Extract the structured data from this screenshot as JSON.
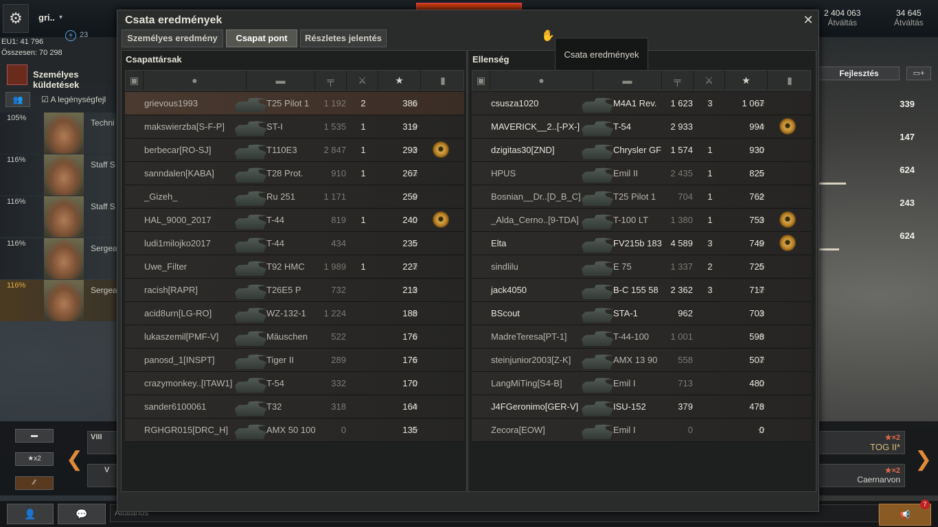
{
  "garage": {
    "account_name": "gri..",
    "plus_value": "23",
    "eu1": "EU1: 41 796",
    "osszesen": "Összesen: 70 298",
    "mission_label": "Személyes küldetések",
    "crew_label": "A legénységfejl",
    "crew": [
      {
        "pct": "105%",
        "rank": "Techni"
      },
      {
        "pct": "116%",
        "rank": "Staff S"
      },
      {
        "pct": "116%",
        "rank": "Staff S"
      },
      {
        "pct": "116%",
        "rank": "Sergea"
      },
      {
        "pct": "116%",
        "rank": "Sergea"
      }
    ],
    "gold": {
      "value": "2 404 063",
      "label": "Átváltás"
    },
    "free_xp": {
      "value": "34 645",
      "label": "Átváltás"
    },
    "fejlesztes": "Fejlesztés",
    "stats": [
      "339",
      "147",
      "624",
      "243",
      "624"
    ],
    "carousel": {
      "btn_x2": "x2",
      "tile_tog": "TOG II*",
      "tile_caer": "Caernarvon",
      "badge": "x2",
      "tile_left1": "VIII",
      "tile_left2": "V"
    },
    "chat_placeholder": "Általános",
    "notif_count": "7"
  },
  "window": {
    "title": "Csata eredmények",
    "tooltip": "Csata eredmények",
    "tabs": [
      "Személyes eredmény",
      "Csapat pont",
      "Részletes jelentés"
    ],
    "allies_title": "Csapattársak",
    "enemies_title": "Ellenség",
    "star": "☆",
    "allies": [
      {
        "name": "grievous1993",
        "tank": "T25 Pilot 1",
        "dmg": "1 192",
        "kills": "2",
        "xp": "386",
        "medal": false,
        "dim": true,
        "me": true
      },
      {
        "name": "makswierzba[S-F-P]",
        "tank": "ST-I",
        "dmg": "1 535",
        "kills": "1",
        "xp": "319",
        "medal": false,
        "dim": true
      },
      {
        "name": "berbecar[RO-SJ]",
        "tank": "T110E3",
        "dmg": "2 847",
        "kills": "1",
        "xp": "293",
        "medal": true,
        "dim": true
      },
      {
        "name": "sanndalen[KABA]",
        "tank": "T28 Prot.",
        "dmg": "910",
        "kills": "1",
        "xp": "267",
        "medal": false,
        "dim": true
      },
      {
        "name": "_Gizeh_",
        "tank": "Ru 251",
        "dmg": "1 171",
        "kills": "",
        "xp": "259",
        "medal": false,
        "dim": true
      },
      {
        "name": "HAL_9000_2017",
        "tank": "T-44",
        "dmg": "819",
        "kills": "1",
        "xp": "240",
        "medal": true,
        "dim": true
      },
      {
        "name": "ludi1milojko2017",
        "tank": "T-44",
        "dmg": "434",
        "kills": "",
        "xp": "235",
        "medal": false,
        "dim": true
      },
      {
        "name": "Uwe_Filter",
        "tank": "T92 HMC",
        "dmg": "1 989",
        "kills": "1",
        "xp": "227",
        "medal": false,
        "dim": true
      },
      {
        "name": "racish[RAPR]",
        "tank": "T26E5 P",
        "dmg": "732",
        "kills": "",
        "xp": "213",
        "medal": false,
        "dim": true
      },
      {
        "name": "acid8urn[LG-RO]",
        "tank": "WZ-132-1",
        "dmg": "1 224",
        "kills": "",
        "xp": "188",
        "medal": false,
        "dim": true
      },
      {
        "name": "lukaszemil[PMF-V]",
        "tank": "Mäuschen",
        "dmg": "522",
        "kills": "",
        "xp": "176",
        "medal": false,
        "dim": true
      },
      {
        "name": "panosd_1[INSPT]",
        "tank": "Tiger II",
        "dmg": "289",
        "kills": "",
        "xp": "176",
        "medal": false,
        "dim": true
      },
      {
        "name": "crazymonkey..[ITAW1]",
        "tank": "T-54",
        "dmg": "332",
        "kills": "",
        "xp": "170",
        "medal": false,
        "dim": true
      },
      {
        "name": "sander6100061",
        "tank": "T32",
        "dmg": "318",
        "kills": "",
        "xp": "164",
        "medal": false,
        "dim": true
      },
      {
        "name": "RGHGR015[DRC_H]",
        "tank": "AMX 50 100",
        "dmg": "0",
        "kills": "",
        "xp": "135",
        "medal": false,
        "dim": true
      }
    ],
    "enemies": [
      {
        "name": "csusza1020",
        "tank": "M4A1 Rev.",
        "dmg": "1 623",
        "kills": "3",
        "xp": "1 067",
        "medal": false,
        "dim": false,
        "bright": true
      },
      {
        "name": "MAVERICK__2..[-PX-]",
        "tank": "T-54",
        "dmg": "2 933",
        "kills": "",
        "xp": "994",
        "medal": true,
        "dim": false,
        "bright": true
      },
      {
        "name": "dzigitas30[ZND]",
        "tank": "Chrysler GF",
        "dmg": "1 574",
        "kills": "1",
        "xp": "930",
        "medal": false,
        "dim": false,
        "bright": true
      },
      {
        "name": "HPUS",
        "tank": "Emil II",
        "dmg": "2 435",
        "kills": "1",
        "xp": "825",
        "medal": false,
        "dim": true
      },
      {
        "name": "Bosnian__Dr..[D_B_C]",
        "tank": "T25 Pilot 1",
        "dmg": "704",
        "kills": "1",
        "xp": "762",
        "medal": false,
        "dim": true
      },
      {
        "name": "_Alda_Cerno..[9-TDA]",
        "tank": "T-100 LT",
        "dmg": "1 380",
        "kills": "1",
        "xp": "753",
        "medal": true,
        "dim": true
      },
      {
        "name": "Elta",
        "tank": "FV215b 183",
        "dmg": "4 589",
        "kills": "3",
        "xp": "749",
        "medal": true,
        "dim": false,
        "bright": true
      },
      {
        "name": "sindlilu",
        "tank": "E 75",
        "dmg": "1 337",
        "kills": "2",
        "xp": "725",
        "medal": false,
        "dim": true
      },
      {
        "name": "jack4050",
        "tank": "B-C 155 58",
        "dmg": "2 362",
        "kills": "3",
        "xp": "717",
        "medal": false,
        "dim": false,
        "bright": true
      },
      {
        "name": "BScout",
        "tank": "STA-1",
        "dmg": "962",
        "kills": "",
        "xp": "703",
        "medal": false,
        "dim": false,
        "bright": true
      },
      {
        "name": "MadreTeresa[PT-1]",
        "tank": "T-44-100",
        "dmg": "1 001",
        "kills": "",
        "xp": "598",
        "medal": false,
        "dim": true
      },
      {
        "name": "steinjunior2003[Z-K]",
        "tank": "AMX 13 90",
        "dmg": "558",
        "kills": "",
        "xp": "507",
        "medal": false,
        "dim": true
      },
      {
        "name": "LangMiTing[S4-B]",
        "tank": "Emil I",
        "dmg": "713",
        "kills": "",
        "xp": "480",
        "medal": false,
        "dim": true
      },
      {
        "name": "J4FGeronimo[GER-V]",
        "tank": "ISU-152",
        "dmg": "379",
        "kills": "",
        "xp": "478",
        "medal": false,
        "dim": false,
        "bright": true
      },
      {
        "name": "Zecora[EOW]",
        "tank": "Emil I",
        "dmg": "0",
        "kills": "",
        "xp": "0",
        "medal": false,
        "dim": true
      }
    ]
  }
}
